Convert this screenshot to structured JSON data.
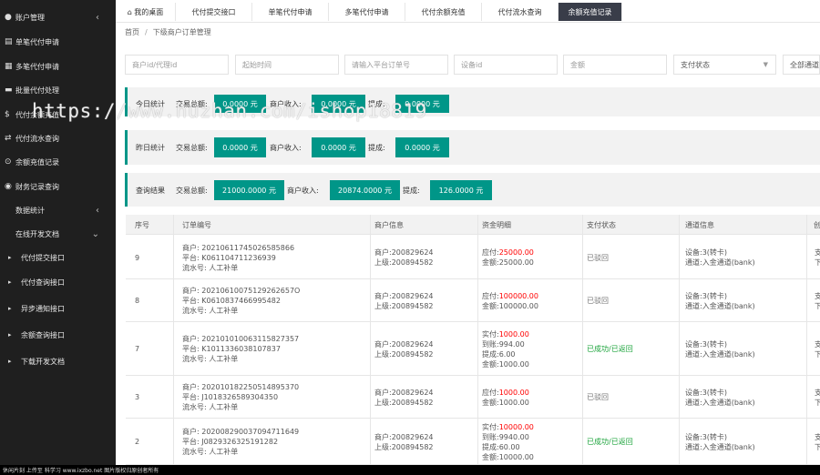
{
  "sidebar": {
    "items": [
      {
        "icon": "user-icon",
        "glyph": "●",
        "label": "账户管理",
        "chevron": "‹"
      },
      {
        "icon": "doc-icon",
        "glyph": "▤",
        "label": "单笔代付申请"
      },
      {
        "icon": "stack-icon",
        "glyph": "▦",
        "label": "多笔代付申请"
      },
      {
        "icon": "batch-icon",
        "glyph": "▬",
        "label": "批量代付处理"
      },
      {
        "icon": "dollar-icon",
        "glyph": "$",
        "label": "代付余额充值"
      },
      {
        "icon": "flow-icon",
        "glyph": "⇄",
        "label": "代付流水查询"
      },
      {
        "icon": "recharge-icon",
        "glyph": "⊙",
        "label": "余额充值记录"
      },
      {
        "icon": "finance-icon",
        "glyph": "◉",
        "label": "财务记录查询"
      },
      {
        "icon": "",
        "glyph": "",
        "label": "数据统计",
        "chevron": "‹"
      },
      {
        "icon": "",
        "glyph": "",
        "label": "在线开发文档",
        "chevron": "⌄"
      },
      {
        "icon": "caret-icon",
        "glyph": "▸",
        "label": "代付提交接口"
      },
      {
        "icon": "caret-icon",
        "glyph": "▸",
        "label": "代付查询接口"
      },
      {
        "icon": "caret-icon",
        "glyph": "▸",
        "label": "异步通知接口"
      },
      {
        "icon": "caret-icon",
        "glyph": "▸",
        "label": "余额查询接口"
      },
      {
        "icon": "caret-icon",
        "glyph": "▸",
        "label": "下载开发文档"
      }
    ]
  },
  "tabs": [
    {
      "label": "⌂ 我的桌面",
      "active": false
    },
    {
      "label": "代付提交接口",
      "active": false
    },
    {
      "label": "单笔代付申请",
      "active": false
    },
    {
      "label": "多笔代付申请",
      "active": false
    },
    {
      "label": "代付余额充值",
      "active": false
    },
    {
      "label": "代付流水查询",
      "active": false
    },
    {
      "label": "余额充值记录",
      "active": true
    }
  ],
  "breadcrumb": {
    "home": "首页",
    "sep": "/",
    "current": "下级商户订单管理"
  },
  "filters": {
    "merchant": "商户id/代理id",
    "start_time": "起始时间",
    "order_no": "请输入平台订单号",
    "device_id": "设备id",
    "amount": "金额",
    "pay_status": "支付状态",
    "channel": "全部通道"
  },
  "stats": {
    "today": {
      "label": "今日统计",
      "total_label": "交易总额:",
      "total": "0.0000 元",
      "merchant_label": "商户收入:",
      "merchant": "0.0000 元",
      "fee_label": "提成:",
      "fee": "0.0000 元"
    },
    "yesterday": {
      "label": "昨日统计",
      "total_label": "交易总额:",
      "total": "0.0000 元",
      "merchant_label": "商户收入:",
      "merchant": "0.0000 元",
      "fee_label": "提成:",
      "fee": "0.0000 元"
    },
    "query": {
      "label": "查询结果",
      "total_label": "交易总额:",
      "total": "21000.0000 元",
      "merchant_label": "商户收入:",
      "merchant": "20874.0000 元",
      "fee_label": "提成:",
      "fee": "126.0000 元"
    }
  },
  "table": {
    "headers": [
      "序号",
      "订单编号",
      "商户信息",
      "资金明细",
      "支付状态",
      "通道信息",
      "创"
    ],
    "rows": [
      {
        "no": "9",
        "order": [
          "商户: 20210611745026585866",
          "平台: K061104711236939",
          "流水号: 人工补单"
        ],
        "merchant": [
          "商户:200829624",
          "上级:200894582"
        ],
        "funds": [
          {
            "label": "应付:",
            "value": "25000.00",
            "red": true
          },
          {
            "label": "金额:",
            "value": "25000.00",
            "red": false
          }
        ],
        "status": "已驳回",
        "status_color": "muted",
        "channel": [
          "设备:3(转卡)",
          "通道:入金通道(bank)"
        ],
        "extra": [
          "支",
          "下"
        ]
      },
      {
        "no": "8",
        "order": [
          "商户: 20210610075129262657O",
          "平台: K0610837466995482",
          "流水号: 人工补单"
        ],
        "merchant": [
          "商户:200829624",
          "上级:200894582"
        ],
        "funds": [
          {
            "label": "应付:",
            "value": "100000.00",
            "red": true
          },
          {
            "label": "金额:",
            "value": "100000.00",
            "red": false
          }
        ],
        "status": "已驳回",
        "status_color": "muted",
        "channel": [
          "设备:3(转卡)",
          "通道:入金通道(bank)"
        ],
        "extra": [
          "支",
          "下"
        ]
      },
      {
        "no": "7",
        "order": [
          "商户: 20210101006311582735​7",
          "平台: K101133603810783​7",
          "流水号: 人工补单"
        ],
        "merchant": [
          "商户:200829624",
          "上级:200894582"
        ],
        "funds": [
          {
            "label": "实付:",
            "value": "1000.00",
            "red": true
          },
          {
            "label": "到账:",
            "value": "994.00",
            "red": false
          },
          {
            "label": "提成:",
            "value": "6.00",
            "red": false
          },
          {
            "label": "金额:",
            "value": "1000.00",
            "red": false
          }
        ],
        "status": "已成功/已返回",
        "status_color": "green",
        "channel": [
          "设备:3(转卡)",
          "通道:入金通道(bank)"
        ],
        "extra": [
          "支",
          "下"
        ]
      },
      {
        "no": "3",
        "order": [
          "商户: 20201018225051489537​0",
          "平台: J101832658930435​0",
          "流水号: 人工补单"
        ],
        "merchant": [
          "商户:200829624",
          "上级:200894582"
        ],
        "funds": [
          {
            "label": "应付:",
            "value": "1000.00",
            "red": true
          },
          {
            "label": "金额:",
            "value": "1000.00",
            "red": false
          }
        ],
        "status": "已驳回",
        "status_color": "muted",
        "channel": [
          "设备:3(转卡)",
          "通道:入金通道(bank)"
        ],
        "extra": [
          "支",
          "下"
        ]
      },
      {
        "no": "2",
        "order": [
          "商户: 20200829003709471164​9",
          "平台: J082932632519128​2",
          "流水号: 人工补单"
        ],
        "merchant": [
          "商户:200829624",
          "上级:200894582"
        ],
        "funds": [
          {
            "label": "实付:",
            "value": "10000.00",
            "red": true
          },
          {
            "label": "到账:",
            "value": "9940.00",
            "red": false
          },
          {
            "label": "提成:",
            "value": "60.00",
            "red": false
          },
          {
            "label": "金额:",
            "value": "10000.00",
            "red": false
          }
        ],
        "status": "已成功/已返回",
        "status_color": "green",
        "channel": [
          "设备:3(转卡)",
          "通道:入金通道(bank)"
        ],
        "extra": [
          "支",
          "下"
        ]
      }
    ]
  },
  "watermark": "https://www.huzhan.com/ishop18819",
  "footer": "休闲片刻   上传至  科学习  www.ixzbo.net  图片版权归原创者所有",
  "colors": {
    "accent": "#009688",
    "sidebar": "#1f1f1f",
    "active_tab": "#393d49",
    "red": "#ff0000",
    "green": "#1aa33a"
  }
}
